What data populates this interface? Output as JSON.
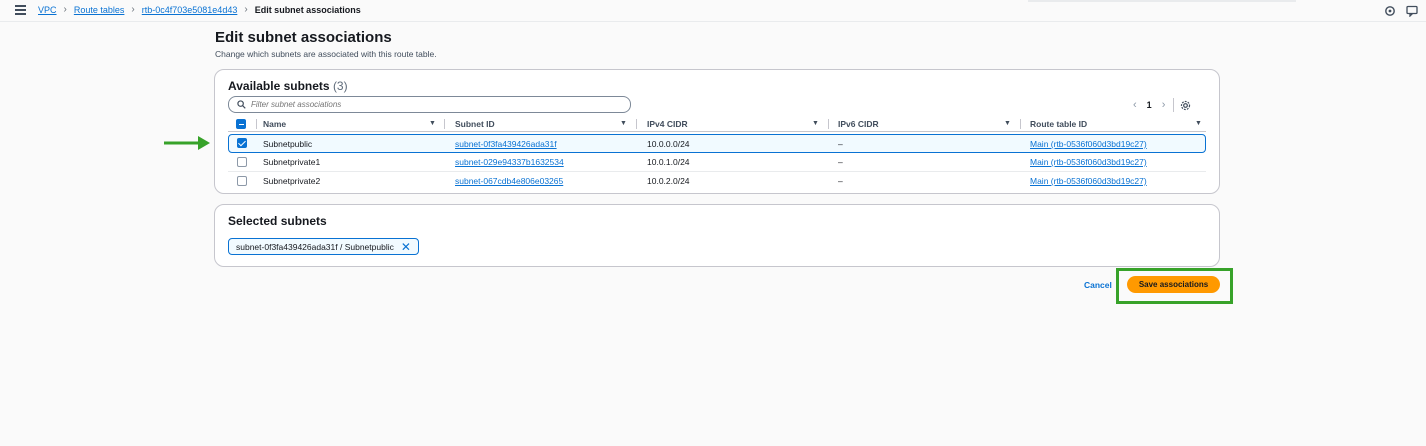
{
  "breadcrumb": {
    "items": [
      "VPC",
      "Route tables",
      "rtb-0c4f703e5081e4d43"
    ],
    "current": "Edit subnet associations"
  },
  "page": {
    "title": "Edit subnet associations",
    "description": "Change which subnets are associated with this route table."
  },
  "available": {
    "heading": "Available subnets",
    "count": "(3)",
    "filter_placeholder": "Filter subnet associations",
    "page_number": "1",
    "columns": [
      "Name",
      "Subnet ID",
      "IPv4 CIDR",
      "IPv6 CIDR",
      "Route table ID"
    ],
    "rows": [
      {
        "name": "Subnetpublic",
        "subnet_id": "subnet-0f3fa439426ada31f",
        "ipv4": "10.0.0.0/24",
        "ipv6": "–",
        "route_table": "Main (rtb-0536f060d3bd19c27)",
        "checked": true
      },
      {
        "name": "Subnetprivate1",
        "subnet_id": "subnet-029e94337b1632534",
        "ipv4": "10.0.1.0/24",
        "ipv6": "–",
        "route_table": "Main (rtb-0536f060d3bd19c27)",
        "checked": false
      },
      {
        "name": "Subnetprivate2",
        "subnet_id": "subnet-067cdb4e806e03265",
        "ipv4": "10.0.2.0/24",
        "ipv6": "–",
        "route_table": "Main (rtb-0536f060d3bd19c27)",
        "checked": false
      }
    ]
  },
  "selected": {
    "heading": "Selected subnets",
    "token": "subnet-0f3fa439426ada31f / Subnetpublic"
  },
  "actions": {
    "cancel": "Cancel",
    "save": "Save associations"
  },
  "colors": {
    "accent": "#0972d3",
    "primary_button": "#ff9900",
    "annotation_green": "#37a229"
  },
  "icons": [
    "menu-icon",
    "search-icon",
    "settings-icon",
    "notifications-icon",
    "feedback-icon",
    "dismiss-icon",
    "sort-icon"
  ]
}
